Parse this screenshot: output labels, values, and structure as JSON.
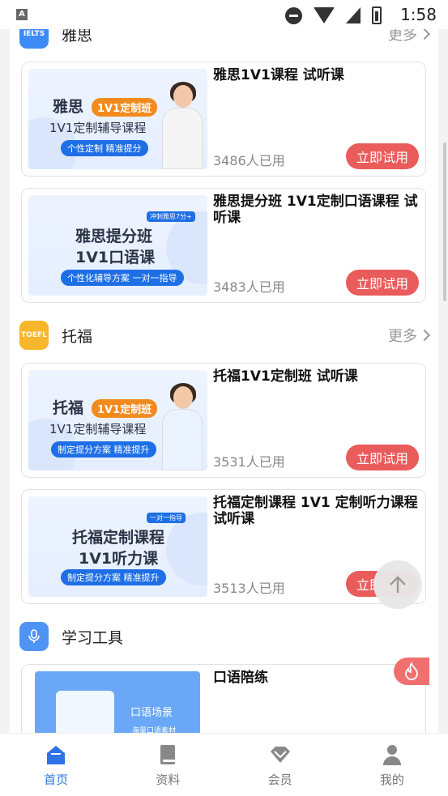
{
  "status_bar": {
    "time": "1:58",
    "app_icon_letter": "A"
  },
  "sections": {
    "ielts": {
      "logo_text": "IELTS",
      "title": "雅思",
      "more": "更多"
    },
    "toefl": {
      "logo_text": "TOEFL",
      "title": "托福",
      "more": "更多"
    },
    "tools": {
      "title": "学习工具"
    }
  },
  "courses": [
    {
      "title": "雅思1V1课程 试听课",
      "used": "3486人已用",
      "button": "立即试用",
      "thumb": {
        "heading": "雅思",
        "pill": "1V1定制班",
        "subtitle": "1V1定制辅导课程",
        "banner": "个性定制 精准提分"
      }
    },
    {
      "title": "雅思提分班 1V1定制口语课程  试听课",
      "used": "3483人已用",
      "button": "立即试用",
      "thumb": {
        "heading": "雅思提分班",
        "tag": "冲刺雅思7分+",
        "subtitle": "1V1口语课",
        "banner": "个性化辅导方案 一对一指导"
      }
    },
    {
      "title": "托福1V1定制班 试听课",
      "used": "3531人已用",
      "button": "立即试用",
      "thumb": {
        "heading": "托福",
        "pill": "1V1定制班",
        "subtitle": "1V1定制辅导课程",
        "banner": "制定提分方案 精准提升"
      }
    },
    {
      "title": "托福定制课程 1V1 定制听力课程  试听课",
      "used": "3513人已用",
      "button": "立即试用",
      "thumb": {
        "heading": "托福定制课程",
        "tag": "一对一指导",
        "subtitle": "1V1听力课",
        "banner": "制定提分方案 精准提升"
      }
    },
    {
      "title": "口语陪练",
      "thumb": {
        "heading": "口语场景",
        "subtitle": "海量口语素材"
      }
    }
  ],
  "tabbar": [
    {
      "label": "首页",
      "icon": "home-icon",
      "active": true
    },
    {
      "label": "资料",
      "icon": "book-icon",
      "active": false
    },
    {
      "label": "会员",
      "icon": "diamond-icon",
      "active": false
    },
    {
      "label": "我的",
      "icon": "person-icon",
      "active": false
    }
  ],
  "colors": {
    "accent": "#2e74e6",
    "button": "#ea5b5b",
    "ielts_logo": "#3d8bf7",
    "toefl_logo": "#f8b62c",
    "tools_logo": "#4f94f5"
  }
}
